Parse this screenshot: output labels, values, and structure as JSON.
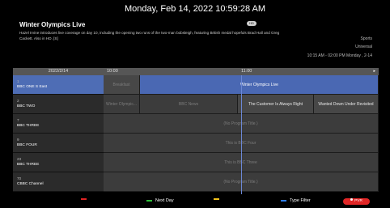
{
  "topbar": {
    "datetime": "Monday, Feb 14, 2022 10:59:28 AM"
  },
  "info": {
    "title": "Winter Olympics Live",
    "description": "Hazel Irvine introduces live coverage on day 10, including the opening two runs of the two-man bobsleigh, featuring British medal hopefuls Brad Hall and Greg Cackett. Also in HD. [S]",
    "badge": "HD",
    "genre": "Sports",
    "variant": "Universal",
    "timeslot": "10:15 AM - 02:00 PM  Monday , 2-14"
  },
  "grid": {
    "date": "2022/2/14",
    "time1": "10:00",
    "time2": "11:00",
    "arrow": "▸",
    "rows": [
      {
        "num": "1",
        "name": "BBC ONE S East",
        "programs": [
          {
            "title": "Breakfast"
          },
          {
            "title": "Winter Olympics Live"
          }
        ]
      },
      {
        "num": "2",
        "name": "BBC TWO",
        "programs": [
          {
            "title": "Winter Olympic..."
          },
          {
            "title": "BBC News"
          },
          {
            "title": "The Customer Is Always Right"
          },
          {
            "title": "Wanted Down Under Revisited"
          }
        ]
      },
      {
        "num": "7",
        "name": "BBC THREE",
        "programs": [
          {
            "title": "(No Program Title.)"
          }
        ]
      },
      {
        "num": "9",
        "name": "BBC FOUR",
        "programs": [
          {
            "title": "This is BBC Four"
          }
        ]
      },
      {
        "num": "23",
        "name": "BBC THREE",
        "programs": [
          {
            "title": "This is BBC Three"
          }
        ]
      },
      {
        "num": "70",
        "name": "CBBC Channel",
        "programs": [
          {
            "title": "(No Program Title.)"
          }
        ]
      }
    ]
  },
  "footer": {
    "green_label": "Next Day",
    "blue_label": "Type Filter",
    "pvr_label": "PVR",
    "colors": {
      "red": "#e02424",
      "green": "#2fbf3a",
      "yellow": "#f2c21b",
      "blue": "#2f7ff0"
    }
  }
}
